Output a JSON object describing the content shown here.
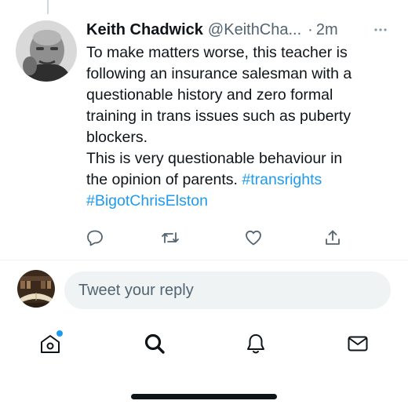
{
  "tweet": {
    "author_name": "Keith Chadwick",
    "author_handle": "@KeithCha...",
    "separator": "·",
    "timestamp": "2m",
    "text_lines": [
      "To make matters worse, this teacher is",
      "following an insurance salesman with a",
      "questionable history and zero formal",
      "training in trans issues such as puberty",
      "blockers.",
      "This is very questionable behaviour in",
      "the opinion of parents."
    ],
    "hashtags": [
      "#transrights",
      "#BigotChrisElston"
    ],
    "avatar_icon": "author-photo",
    "more_icon": "more-horizontal-icon"
  },
  "actions": [
    {
      "name": "reply",
      "icon": "reply-icon"
    },
    {
      "name": "retweet",
      "icon": "retweet-icon"
    },
    {
      "name": "like",
      "icon": "heart-icon"
    },
    {
      "name": "share",
      "icon": "share-icon"
    }
  ],
  "reply": {
    "placeholder": "Tweet your reply",
    "avatar_icon": "user-photo"
  },
  "nav": [
    {
      "name": "home",
      "icon": "home-icon",
      "has_notification_dot": true
    },
    {
      "name": "search",
      "icon": "search-icon"
    },
    {
      "name": "notifications",
      "icon": "bell-icon"
    },
    {
      "name": "messages",
      "icon": "mail-icon"
    }
  ],
  "colors": {
    "accent": "#1d9bf0",
    "text": "#0f1419",
    "muted": "#536471",
    "input_bg": "#eff3f4"
  }
}
